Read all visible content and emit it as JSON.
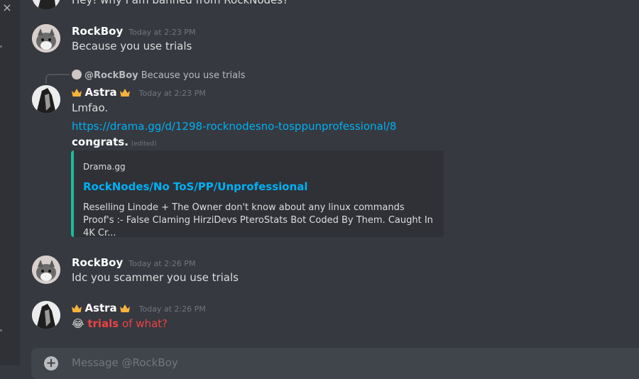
{
  "window": {
    "close_label": "×"
  },
  "messages": {
    "partial_top": {
      "text": "Hey! why I am banned from RockNodes?"
    },
    "m1": {
      "author": "RockBoy",
      "timestamp": "Today at 2:23 PM",
      "text": "Because you use trials"
    },
    "m2": {
      "reply": {
        "mention": "@RockBoy",
        "text": "Because you use trials"
      },
      "author": "Astra",
      "timestamp": "Today at 2:23 PM",
      "text": "Lmfao.",
      "link": "https://drama.gg/d/1298-rocknodesno-tosppunprofessional/8",
      "bold_text": "congrats.",
      "edited": "(edited)",
      "embed": {
        "provider": "Drama.gg",
        "title": "RockNodes/No ToS/PP/Unprofessional",
        "description": "Reselling Linode + The Owner don't know about any linux commands Proof's :- False Claming HirziDevs PteroStats Bot Coded By Them. Caught In 4K Cr...",
        "accent_color": "#1abc9c"
      }
    },
    "m3": {
      "author": "RockBoy",
      "timestamp": "Today at 2:26 PM",
      "text": "Idc you scammer you use trials"
    },
    "m4": {
      "author": "Astra",
      "timestamp": "Today at 2:26 PM",
      "emoji": "😂",
      "bold_text": "trials",
      "text": " of what?"
    }
  },
  "composer": {
    "placeholder": "Message @RockBoy",
    "plus_icon": "+"
  },
  "colors": {
    "background": "#36393f",
    "link": "#00b0f4",
    "red": "#ed4245"
  }
}
